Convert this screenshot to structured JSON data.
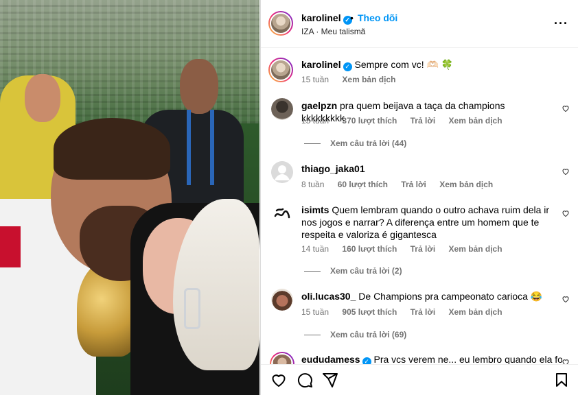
{
  "post": {
    "author": "karolinel",
    "follow_label": "Theo dõi",
    "separator": "•",
    "music": "IZA · Meu talismã",
    "more_label": "···"
  },
  "caption": {
    "username": "karolinel",
    "text": "Sempre com vc! 🫶🏻 🍀",
    "time": "15 tuần",
    "translate": "Xem bản dịch"
  },
  "comments": [
    {
      "username": "gaelpzn",
      "text": "pra quem beijava a taça da champions kkkkkkkkk",
      "time": "15 tuần",
      "likes": "370 lượt thích",
      "reply": "Trả lời",
      "translate": "Xem bản dịch",
      "view_replies": "Xem câu trả lời (44)"
    },
    {
      "username": "thiago_jaka01",
      "text": "",
      "time": "8 tuần",
      "likes": "60 lượt thích",
      "reply": "Trả lời",
      "translate": "Xem bản dịch",
      "view_replies": ""
    },
    {
      "username": "isimts",
      "text": "Quem lembram quando o outro achava ruim dela ir nos jogos e narrar? A diferença entre um homem que te respeita e valoriza é gigantesca",
      "time": "14 tuần",
      "likes": "160 lượt thích",
      "reply": "Trả lời",
      "translate": "Xem bản dịch",
      "view_replies": "Xem câu trả lời (2)"
    },
    {
      "username": "oli.lucas30_",
      "text": "De Champions pra campeonato carioca 😂",
      "time": "15 tuần",
      "likes": "905 lượt thích",
      "reply": "Trả lời",
      "translate": "Xem bản dịch",
      "view_replies": "Xem câu trả lời (69)"
    },
    {
      "username": "eududamess",
      "text": "Pra vcs verem ne... eu lembro quando ela foi",
      "time": "",
      "likes": "",
      "reply": "",
      "translate": "",
      "view_replies": ""
    }
  ],
  "icons": {
    "like": "heart-icon",
    "comment": "comment-icon",
    "share": "share-icon",
    "save": "bookmark-icon",
    "verified": "verified-badge-icon",
    "more": "more-options-icon",
    "comment_like": "heart-outline-icon"
  },
  "colors": {
    "accent": "#0095f6",
    "muted": "#737373",
    "border": "#dbdbdb"
  }
}
